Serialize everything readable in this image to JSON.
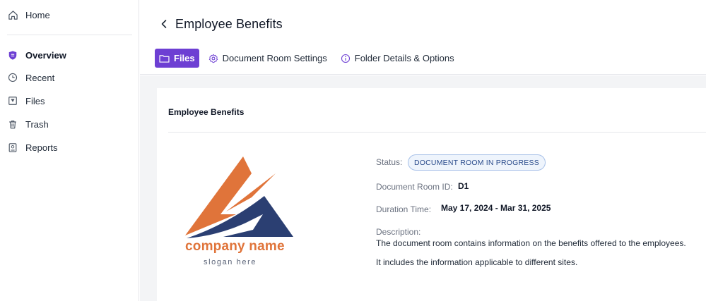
{
  "sidebar": {
    "items": [
      {
        "label": "Home",
        "icon": "home-icon"
      },
      {
        "label": "Overview",
        "icon": "shield-icon",
        "active": true
      },
      {
        "label": "Recent",
        "icon": "clock-icon"
      },
      {
        "label": "Files",
        "icon": "file-icon"
      },
      {
        "label": "Trash",
        "icon": "trash-icon"
      },
      {
        "label": "Reports",
        "icon": "report-icon"
      }
    ]
  },
  "header": {
    "title": "Employee Benefits",
    "tabs": [
      {
        "label": "Files",
        "icon": "folder-icon",
        "active": true
      },
      {
        "label": "Document Room Settings",
        "icon": "gear-icon"
      },
      {
        "label": "Folder Details & Options",
        "icon": "info-icon"
      }
    ]
  },
  "card": {
    "title": "Employee Benefits",
    "logo": {
      "name": "company name",
      "slogan": "slogan here"
    },
    "status_label": "Status:",
    "status_value": "DOCUMENT ROOM IN PROGRESS",
    "room_id_label": "Document Room ID:",
    "room_id_value": "D1",
    "duration_label": "Duration Time:",
    "duration_value": "May 17, 2024 - Mar 31, 2025",
    "description_label": "Description:",
    "description_line1": "The document room contains information on the benefits offered to the employees.",
    "description_line2": "It includes the information applicable to different sites."
  },
  "colors": {
    "accent": "#6d3fd3",
    "logo_orange": "#e0743a",
    "logo_navy": "#2b3f72",
    "badge_border": "#a7c0e8"
  }
}
